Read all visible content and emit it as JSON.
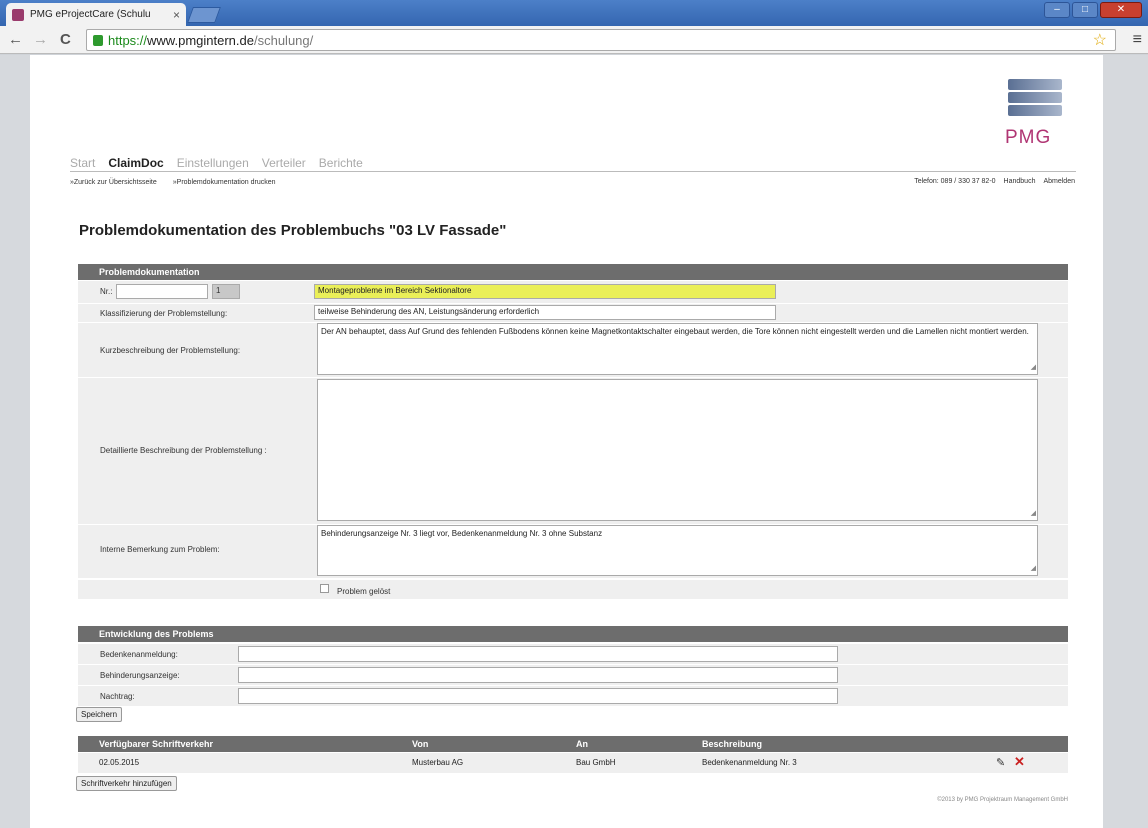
{
  "browser": {
    "tab_title": "PMG eProjectCare (Schulu",
    "tab_close": "×",
    "url_scheme": "https://",
    "url_host": "www.pmgintern.de",
    "url_path": "/schulung/",
    "back": "←",
    "forward": "→",
    "reload": "C",
    "star": "☆",
    "menu": "≡"
  },
  "logo_text": "PMG",
  "nav": {
    "items": [
      "Start",
      "ClaimDoc",
      "Einstellungen",
      "Verteiler",
      "Berichte"
    ],
    "active": "ClaimDoc"
  },
  "subnav": {
    "back": "»Zurück zur Übersichtsseite",
    "print": "»Problemdokumentation drucken"
  },
  "meta": {
    "phone": "Telefon: 089 / 330 37 82-0",
    "manual": "Handbuch",
    "logout": "Abmelden"
  },
  "heading": "Problemdokumentation des Problembuchs \"03 LV Fassade\"",
  "section1": {
    "title": "Problemdokumentation",
    "nr_label": "Nr.:",
    "nr_value": "",
    "nr_suffix": "1",
    "title_value": "Montageprobleme im Bereich Sektionaltore",
    "class_label": "Klassifizierung der Problemstellung:",
    "class_value": "teilweise Behinderung des AN, Leistungsänderung erforderlich",
    "short_label": "Kurzbeschreibung der Problemstellung:",
    "short_value": "Der AN behauptet, dass Auf Grund des fehlenden Fußbodens können keine Magnetkontaktschalter eingebaut werden, die Tore können nicht eingestellt werden und die Lamellen nicht montiert werden.",
    "detail_label": "Detaillierte Beschreibung der Problemstellung :",
    "detail_value": "",
    "internal_label": "Interne Bemerkung zum Problem:",
    "internal_value": "Behinderungsanzeige Nr. 3 liegt vor, Bedenkenanmeldung Nr. 3 ohne Substanz",
    "solved_label": "Problem gelöst"
  },
  "section2": {
    "title": "Entwicklung des Problems",
    "fields": [
      {
        "label": "Bedenkenanmeldung:",
        "value": ""
      },
      {
        "label": "Behinderungsanzeige:",
        "value": ""
      },
      {
        "label": "Nachtrag:",
        "value": ""
      }
    ],
    "save_button": "Speichern"
  },
  "section3": {
    "headers": [
      "Verfügbarer Schriftverkehr",
      "Von",
      "An",
      "Beschreibung"
    ],
    "rows": [
      {
        "date": "02.05.2015",
        "from": "Musterbau AG",
        "to": "Bau GmbH",
        "desc": "Bedenkenanmeldung Nr. 3"
      }
    ],
    "add_button": "Schriftverkehr hinzufügen"
  },
  "footer": "©2013 by PMG Projektraum Management GmbH"
}
